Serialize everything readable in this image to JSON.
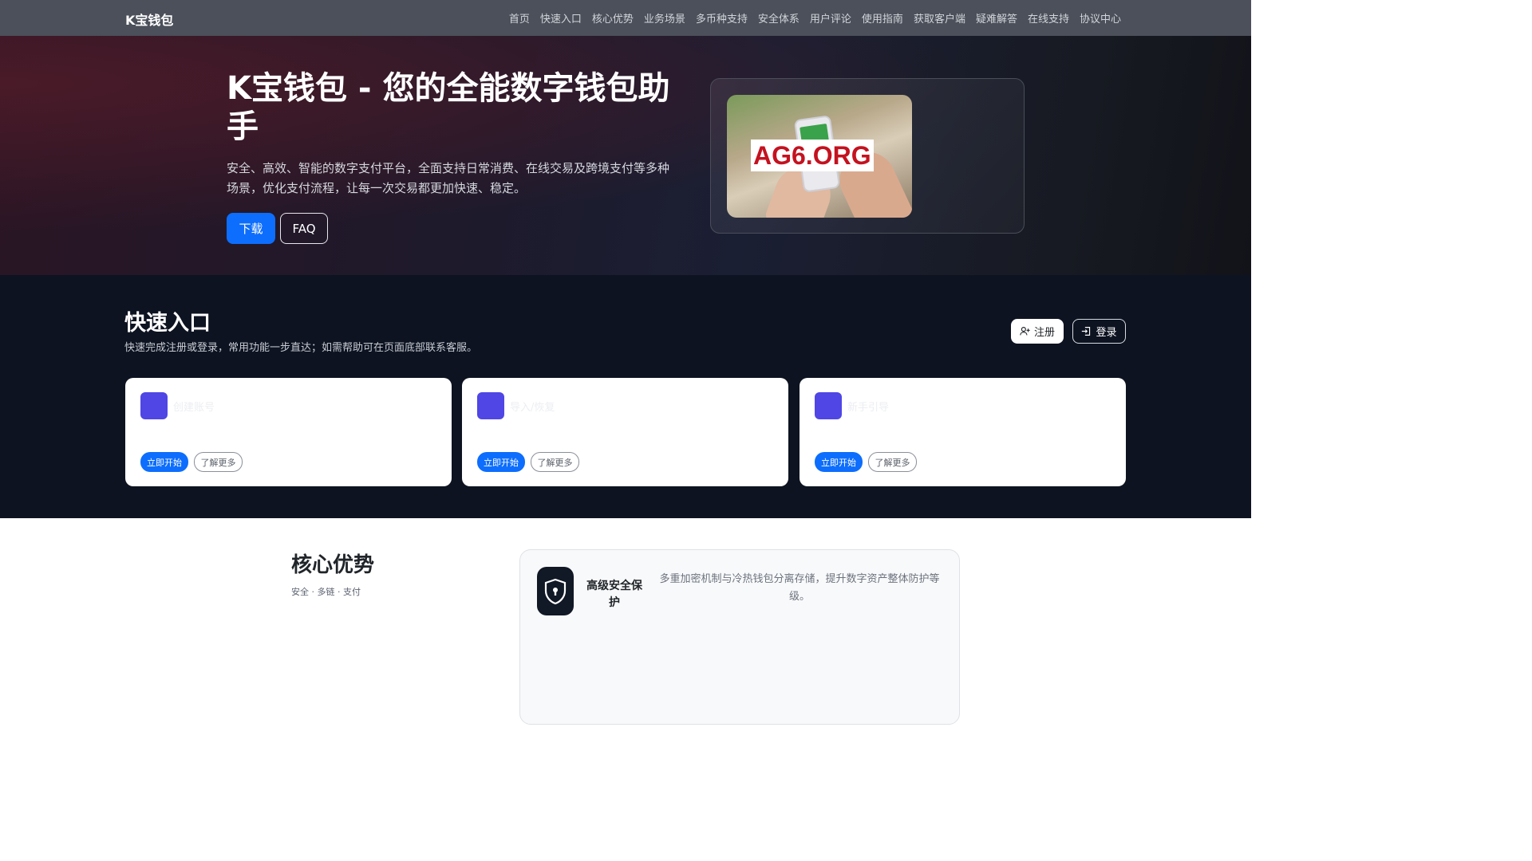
{
  "navbar": {
    "brand": "K宝钱包",
    "links": [
      "首页",
      "快速入口",
      "核心优势",
      "业务场景",
      "多币种支持",
      "安全体系",
      "用户评论",
      "使用指南",
      "获取客户端",
      "疑难解答",
      "在线支持",
      "协议中心"
    ]
  },
  "hero": {
    "title": "K宝钱包 - 您的全能数字钱包助手",
    "description": "安全、高效、智能的数字支付平台，全面支持日常消费、在线交易及跨境支付等多种场景，优化支付流程，让每一次交易都更加快速、稳定。",
    "download_label": "下载",
    "faq_label": "FAQ",
    "image_watermark": "AG6.ORG"
  },
  "quick": {
    "title": "快速入口",
    "subtitle": "快速完成注册或登录，常用功能一步直达；如需帮助可在页面底部联系客服。",
    "register_label": "注册",
    "login_label": "登录",
    "cards": [
      {
        "name": "创建账号",
        "start_label": "立即开始",
        "more_label": "了解更多"
      },
      {
        "name": "导入/恢复",
        "start_label": "立即开始",
        "more_label": "了解更多"
      },
      {
        "name": "新手引导",
        "start_label": "立即开始",
        "more_label": "了解更多"
      }
    ]
  },
  "core": {
    "title": "核心优势",
    "subtitle": "安全 · 多链 · 支付",
    "feature": {
      "icon": "shield-lock-icon",
      "name": "高级安全保护",
      "description": "多重加密机制与冷热钱包分离存储，提升数字资产整体防护等级。"
    }
  },
  "colors": {
    "navbar": "#4b505a",
    "primary": "#0d6efd",
    "quick_bg": "#0d1321",
    "card_icon": "#4f46e5",
    "watermark": "#c4121f"
  }
}
